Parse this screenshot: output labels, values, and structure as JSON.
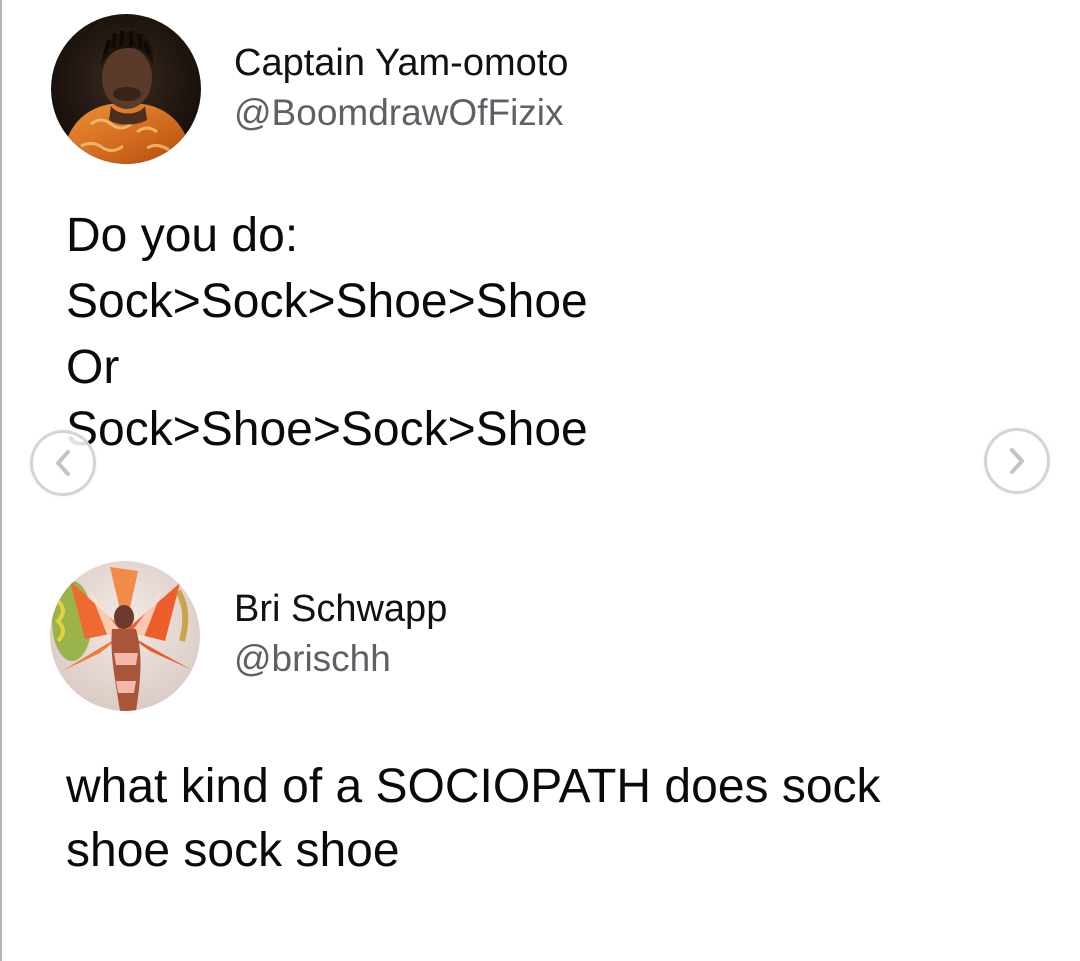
{
  "tweets": [
    {
      "author": {
        "name": "Captain Yam-omoto",
        "handle": "@BoomdrawOfFizix"
      },
      "lines": [
        "Do you do:",
        "Sock>Sock>Shoe>Shoe",
        "Or",
        "Sock>Shoe>Sock>Shoe"
      ]
    },
    {
      "author": {
        "name": "Bri Schwapp",
        "handle": "@brischh"
      },
      "lines": [
        "what kind of a SOCIOPATH does sock",
        "shoe sock shoe"
      ]
    }
  ],
  "navigation": {
    "previous_icon": "chevron-left-icon",
    "next_icon": "chevron-right-icon"
  },
  "colors": {
    "background": "#ffffff",
    "text": "#0a0a0a",
    "handle": "#5d6166",
    "arrow": "#c8c8c8"
  }
}
